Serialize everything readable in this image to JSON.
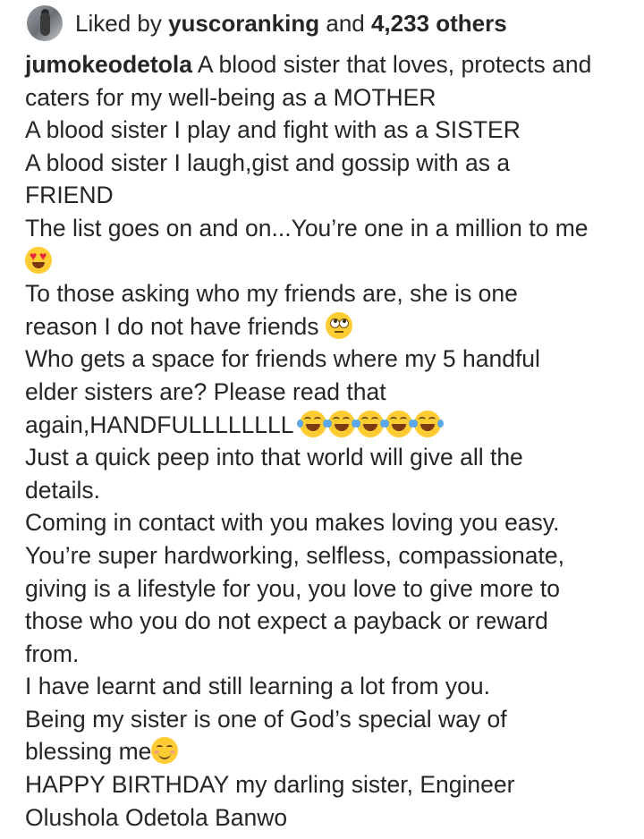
{
  "likes": {
    "prefix": "Liked by ",
    "user": "yuscoranking",
    "middle": " and ",
    "count": "4,233 others"
  },
  "caption": {
    "username": "jumokeodetola",
    "lines": [
      " A blood sister that loves, protects and",
      "caters for my well-being as a MOTHER",
      "A blood sister I play and fight with as a SISTER",
      "A blood sister I laugh,gist and gossip with as a",
      "FRIEND",
      "The list goes on and on...You’re one in a million to me",
      "To those asking who my friends are, she is one",
      "reason I do not have friends ",
      "Who gets a space for friends where my 5 handful",
      "elder sisters are? Please read that",
      "again,HANDFULLLLLLLL ",
      "Just a quick peep into that world will give all the",
      "details.",
      "Coming in contact with you makes loving you easy.",
      "You’re super hardworking, selfless, compassionate,",
      "giving is a lifestyle for you, you love to give more to",
      "those who you do not expect a payback or reward",
      "from.",
      "I have learnt and still learning a lot from you.",
      "Being my sister is one of God’s special way of",
      "blessing me",
      "HAPPY BIRTHDAY my darling sister, Engineer",
      "Olushola Odetola Banwo"
    ]
  },
  "icons": {
    "avatar": "avatar",
    "heart_eyes": "smiling-face-with-heart-eyes-emoji",
    "eye_roll": "face-with-rolling-eyes-emoji",
    "joy": "face-with-tears-of-joy-emoji",
    "smile": "smiling-face-with-smiling-eyes-emoji"
  },
  "colors": {
    "text": "#262626",
    "emoji_yellow": "#ffcc33"
  }
}
